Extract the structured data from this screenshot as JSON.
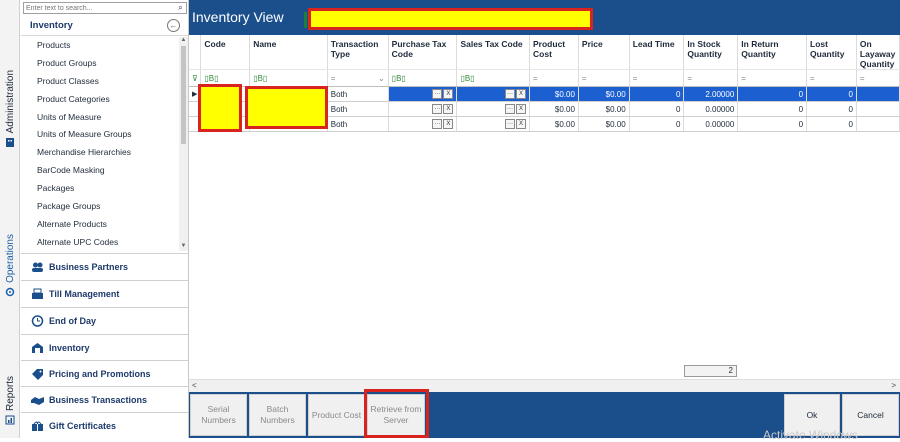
{
  "sidebar_tabs": [
    {
      "label": "Administration",
      "icon": "building-icon"
    },
    {
      "label": "Operations",
      "icon": "gear-icon"
    },
    {
      "label": "Reports",
      "icon": "chart-icon"
    }
  ],
  "nav": {
    "search_placeholder": "Enter text to search...",
    "header": "Inventory",
    "items": [
      "Products",
      "Product Groups",
      "Product Classes",
      "Product Categories",
      "Units of Measure",
      "Units of Measure Groups",
      "Merchandise Hierarchies",
      "BarCode Masking",
      "Packages",
      "Package Groups",
      "Alternate Products",
      "Alternate UPC Codes"
    ],
    "sections": [
      {
        "label": "Business Partners",
        "icon": "people-icon"
      },
      {
        "label": "Till Management",
        "icon": "till-icon"
      },
      {
        "label": "End of Day",
        "icon": "clock-icon"
      },
      {
        "label": "Inventory",
        "icon": "warehouse-icon"
      },
      {
        "label": "Pricing and Promotions",
        "icon": "tag-icon"
      },
      {
        "label": "Business Transactions",
        "icon": "handshake-icon"
      },
      {
        "label": "Gift Certificates",
        "icon": "gift-icon"
      }
    ]
  },
  "main": {
    "title": "Inventory View",
    "columns": [
      "Code",
      "Name",
      "Transaction Type",
      "Purchase Tax Code",
      "Sales Tax Code",
      "Product Cost",
      "Price",
      "Lead Time",
      "In Stock Quantity",
      "In Return Quantity",
      "Lost Quantity",
      "On Layaway Quantity"
    ],
    "rows": [
      {
        "transaction_type": "Both",
        "product_cost": "$0.00",
        "price": "$0.00",
        "lead_time": "0",
        "in_stock": "2.00000",
        "in_return": "0",
        "lost": "0"
      },
      {
        "transaction_type": "Both",
        "product_cost": "$0.00",
        "price": "$0.00",
        "lead_time": "0",
        "in_stock": "0.00000",
        "in_return": "0",
        "lost": "0"
      },
      {
        "transaction_type": "Both",
        "product_cost": "$0.00",
        "price": "$0.00",
        "lead_time": "0",
        "in_stock": "0.00000",
        "in_return": "0",
        "lost": "0"
      }
    ],
    "row_count": "2"
  },
  "actions": {
    "serial_numbers": "Serial Numbers",
    "batch_numbers": "Batch Numbers",
    "product_cost": "Product Cost",
    "retrieve": "Retrieve from Server",
    "ok": "Ok",
    "cancel": "Cancel"
  },
  "watermark": "Activate Windows",
  "colors": {
    "title_bar": "#1a4f8c",
    "selection": "#1b5fd1",
    "redaction_fill": "#ffff00",
    "redaction_border": "#d8231f"
  }
}
